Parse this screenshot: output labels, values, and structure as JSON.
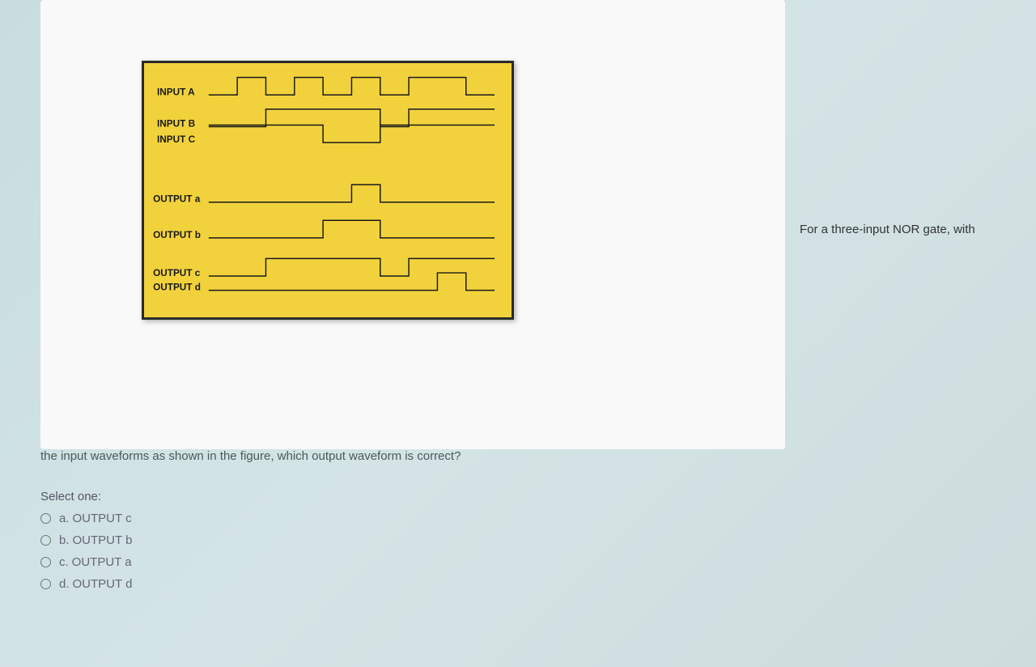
{
  "question": {
    "lead_text_right": "For a three-input NOR gate, with",
    "text_after_figure": "the input waveforms as shown in the figure, which output waveform is correct?",
    "select_label": "Select one:"
  },
  "options": [
    {
      "letter": "a.",
      "text": "OUTPUT c"
    },
    {
      "letter": "b.",
      "text": "OUTPUT b"
    },
    {
      "letter": "c.",
      "text": "OUTPUT a"
    },
    {
      "letter": "d.",
      "text": "OUTPUT d"
    }
  ],
  "figure": {
    "labels": {
      "input_a": "INPUT A",
      "input_b": "INPUT B",
      "input_c": "INPUT C",
      "output_a": "OUTPUT a",
      "output_b": "OUTPUT b",
      "output_c": "OUTPUT c",
      "output_d": "OUTPUT d"
    }
  },
  "chart_data": {
    "type": "timing-diagram",
    "title": "Three-input NOR gate input/output waveforms",
    "time_axis": {
      "start": 0,
      "end": 10,
      "unit": "arbitrary"
    },
    "signals": [
      {
        "name": "INPUT A",
        "role": "input",
        "levels": [
          0,
          1,
          0,
          1,
          0,
          1,
          0,
          1,
          1,
          0
        ]
      },
      {
        "name": "INPUT B",
        "role": "input",
        "levels": [
          0,
          0,
          1,
          1,
          1,
          1,
          0,
          1,
          1,
          1
        ]
      },
      {
        "name": "INPUT C",
        "role": "input",
        "levels": [
          1,
          1,
          1,
          1,
          0,
          0,
          1,
          1,
          1,
          1
        ]
      },
      {
        "name": "OUTPUT a",
        "role": "output",
        "levels": [
          0,
          0,
          0,
          0,
          0,
          1,
          0,
          0,
          0,
          0
        ]
      },
      {
        "name": "OUTPUT b",
        "role": "output",
        "levels": [
          0,
          0,
          0,
          0,
          1,
          1,
          0,
          0,
          0,
          0
        ]
      },
      {
        "name": "OUTPUT c",
        "role": "output",
        "levels": [
          0,
          0,
          1,
          1,
          1,
          1,
          0,
          1,
          1,
          1
        ]
      },
      {
        "name": "OUTPUT d",
        "role": "output",
        "levels": [
          0,
          0,
          0,
          0,
          0,
          0,
          0,
          0,
          1,
          0
        ]
      }
    ]
  }
}
